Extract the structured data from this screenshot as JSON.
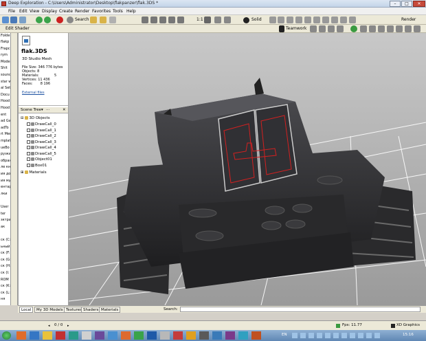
{
  "window": {
    "title": "Deep Exploration - C:\\Users\\Administrator\\Desktop\\flakpanzer\\flak.3DS *"
  },
  "menu": [
    "File",
    "Edit",
    "View",
    "Display",
    "Create",
    "Render",
    "Favorites",
    "Tools",
    "Help"
  ],
  "toolbar": {
    "search_label": "Search",
    "ratio_label": "1:1",
    "solid_label": "Solid",
    "render_label": "Render",
    "edit_shader_label": "Edit Shader",
    "teamwork_label": "Teamwork"
  },
  "left_strip": {
    "top_label": "Folde",
    "items": [
      "flakp",
      "Frapc",
      "rym",
      "Mode",
      "Shit",
      "sounc",
      "star w",
      "al Set",
      "Docu",
      "Hood",
      "Hood",
      "ent",
      "ad Ga",
      "adTo",
      "rt Mer",
      "mplate",
      "ueBo",
      "рузки",
      "обрах",
      "ле кн",
      "ия до",
      "ия му",
      "ентар",
      "лки",
      "",
      "User",
      "ter",
      "зктра",
      "ак",
      "",
      "ск (C:",
      "ьный",
      "ск (F:",
      "ск (G:",
      "ск (H:",
      "ск (I:",
      "ROM",
      "ск (K:",
      "ск (L:",
      "ня"
    ]
  },
  "file_info": {
    "filename": "flak.3DS",
    "type": "3D Studio Mesh",
    "file_size": "File Size: 346 776 bytes",
    "objects": "Objects: 8",
    "materials_label": "Materials:",
    "materials_value": "5",
    "vertices": "Vertices: 11 436",
    "faces": "Faces:       8 196",
    "external_files": "External files"
  },
  "scene_tree": {
    "header": "Scene Tree",
    "more": "...",
    "root": "3D Objects",
    "objects": [
      "DrawCall_0",
      "DrawCall_1",
      "DrawCall_2",
      "DrawCall_3",
      "DrawCall_4",
      "DrawCall_5",
      "Object01",
      "Box01"
    ],
    "materials": "Materials"
  },
  "tabs": [
    "Local",
    "My 3D Models",
    "Textures",
    "Shaders",
    "Materials"
  ],
  "status": {
    "search_label": "Search:",
    "page": "0 / 0",
    "fps": "Fps: 11.77",
    "app": "XD Graphics"
  },
  "taskbar": {
    "lang": "EN",
    "time": "15:16"
  },
  "colors": {
    "viewport_bg": "#b8b8b8",
    "tank_body": "#3a3a3d",
    "hatch_outline": "#d42020",
    "grid_line": "#ffffff"
  }
}
